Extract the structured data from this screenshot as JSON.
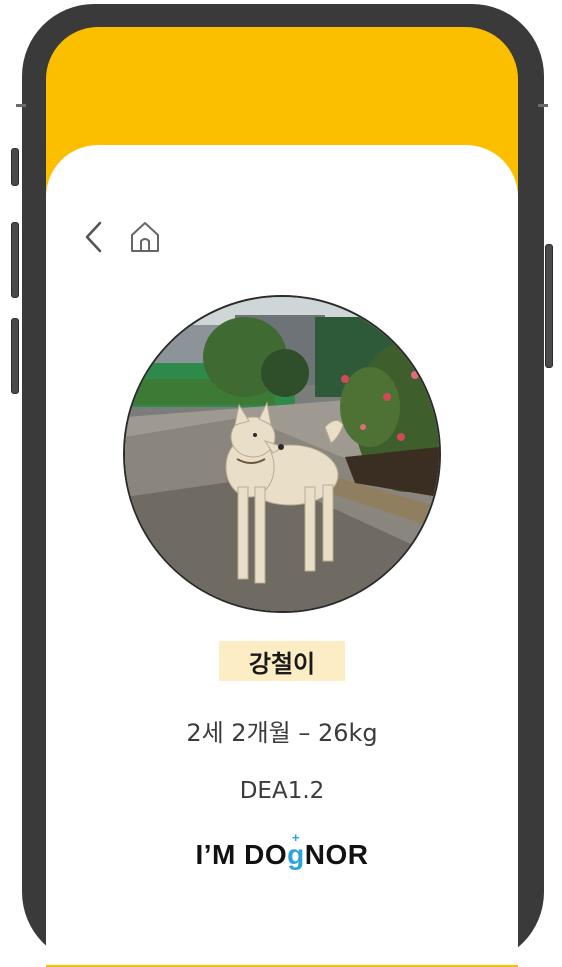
{
  "nav": {
    "back_icon": "chevron-left-icon",
    "home_icon": "home-icon"
  },
  "profile": {
    "photo_alt": "dog-photo",
    "name": "강철이",
    "age_weight": "2세 2개월 – 26kg",
    "blood_type": "DEA1.2"
  },
  "brand": {
    "logo_part1": "I’M DO",
    "logo_g": "g",
    "logo_plus": "+",
    "logo_part2": "NOR"
  },
  "colors": {
    "header": "#fbbf00",
    "name_tag": "#fdedc4",
    "logo_accent": "#2aa3e0"
  }
}
